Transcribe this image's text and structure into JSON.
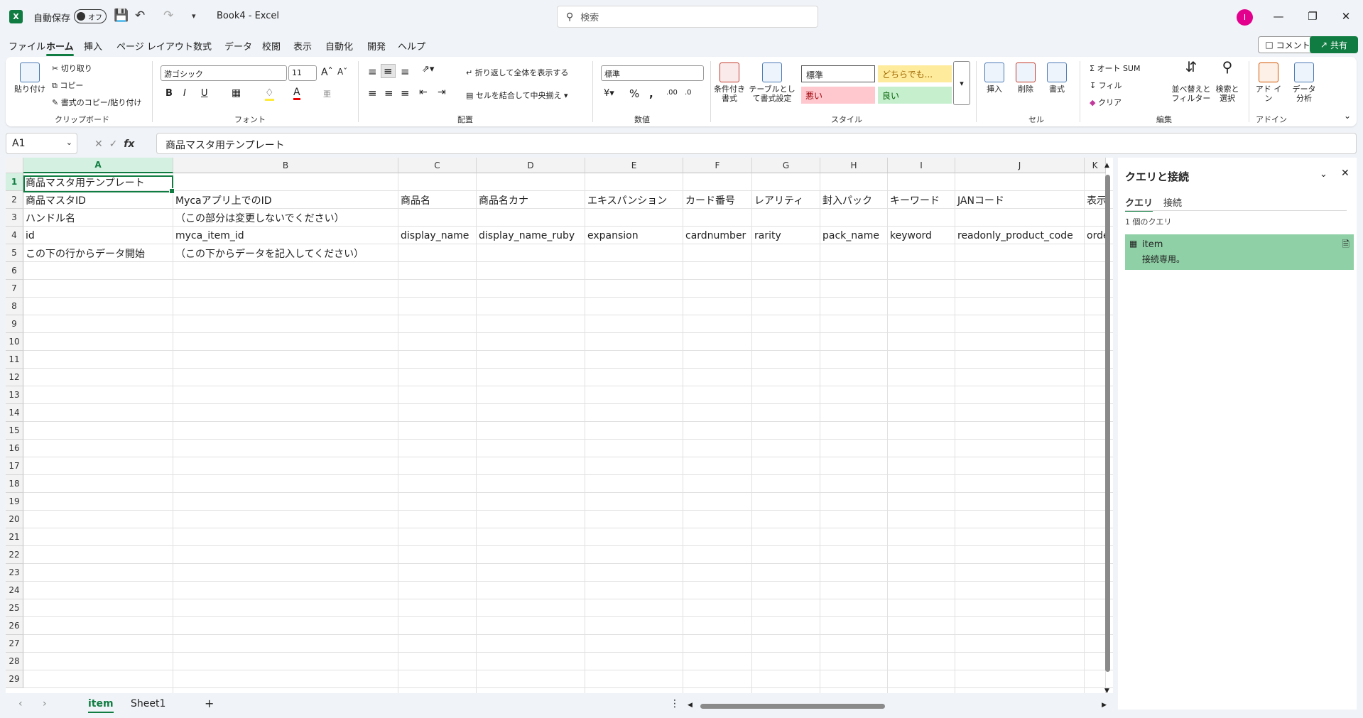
{
  "titlebar": {
    "app_icon": "X",
    "autosave_label": "自動保存",
    "autosave_state": "オフ",
    "doc_title": "Book4  -  Excel",
    "search_placeholder": "検索",
    "avatar_initial": "I"
  },
  "menu": {
    "tabs": [
      "ファイル",
      "ホーム",
      "挿入",
      "ページ レイアウト",
      "数式",
      "データ",
      "校閲",
      "表示",
      "自動化",
      "開発",
      "ヘルプ"
    ],
    "active": "ホーム",
    "comment_label": "コメント",
    "share_label": "共有"
  },
  "ribbon": {
    "clipboard": {
      "paste": "貼り付け",
      "cut": "切り取り",
      "copy": "コピー",
      "format_painter": "書式のコピー/貼り付け",
      "label": "クリップボード"
    },
    "font": {
      "font_name": "游ゴシック",
      "font_size": "11",
      "label": "フォント"
    },
    "alignment": {
      "wrap": "折り返して全体を表示する",
      "merge": "セルを結合して中央揃え",
      "label": "配置"
    },
    "number": {
      "format": "標準",
      "label": "数値"
    },
    "styles": {
      "cond_format": "条件付き書式",
      "table_format": "テーブルとして書式設定",
      "normal": "標準",
      "neutral": "どちらでも...",
      "bad": "悪い",
      "good": "良い",
      "label": "スタイル"
    },
    "cells": {
      "insert": "挿入",
      "delete": "削除",
      "format": "書式",
      "label": "セル"
    },
    "editing": {
      "autosum": "オート SUM",
      "fill": "フィル",
      "clear": "クリア",
      "sort": "並べ替えと フィルター",
      "find": "検索と 選択",
      "label": "編集"
    },
    "addins": {
      "addin": "アド イン",
      "analyze": "データ 分析",
      "label": "アドイン"
    }
  },
  "formula_bar": {
    "name_box": "A1",
    "fx": "fx",
    "content": "商品マスタ用テンプレート"
  },
  "sheet": {
    "columns": [
      "A",
      "B",
      "C",
      "D",
      "E",
      "F",
      "G",
      "H",
      "I",
      "J",
      "K"
    ],
    "row_numbers": [
      "1",
      "2",
      "3",
      "4",
      "5",
      "6",
      "7",
      "8",
      "9",
      "10",
      "11",
      "12",
      "13",
      "14",
      "15",
      "16",
      "17",
      "18",
      "19",
      "20",
      "21",
      "22",
      "23",
      "24",
      "25",
      "26",
      "27",
      "28",
      "29"
    ],
    "rows": [
      [
        "商品マスタ用テンプレート",
        "",
        "",
        "",
        "",
        "",
        "",
        "",
        "",
        "",
        ""
      ],
      [
        "商品マスタID",
        "Mycaアプリ上でのID",
        "商品名",
        "商品名カナ",
        "エキスパンション",
        "カード番号",
        "レアリティ",
        "封入パック",
        "キーワード",
        "JANコード",
        "表示"
      ],
      [
        "ハンドル名",
        "（この部分は変更しないでください）",
        "",
        "",
        "",
        "",
        "",
        "",
        "",
        "",
        ""
      ],
      [
        "id",
        "myca_item_id",
        "display_name",
        "display_name_ruby",
        "expansion",
        "cardnumber",
        "rarity",
        "pack_name",
        "keyword",
        "readonly_product_code",
        "orde"
      ],
      [
        "この下の行からデータ開始",
        "（この下からデータを記入してください）",
        "",
        "",
        "",
        "",
        "",
        "",
        "",
        "",
        ""
      ]
    ],
    "tabs": [
      "item",
      "Sheet1"
    ],
    "active_tab": "item"
  },
  "query_pane": {
    "title": "クエリと接続",
    "tabs": [
      "クエリ",
      "接続"
    ],
    "count": "1 個のクエリ",
    "item_name": "item",
    "item_desc": "接続専用。"
  }
}
